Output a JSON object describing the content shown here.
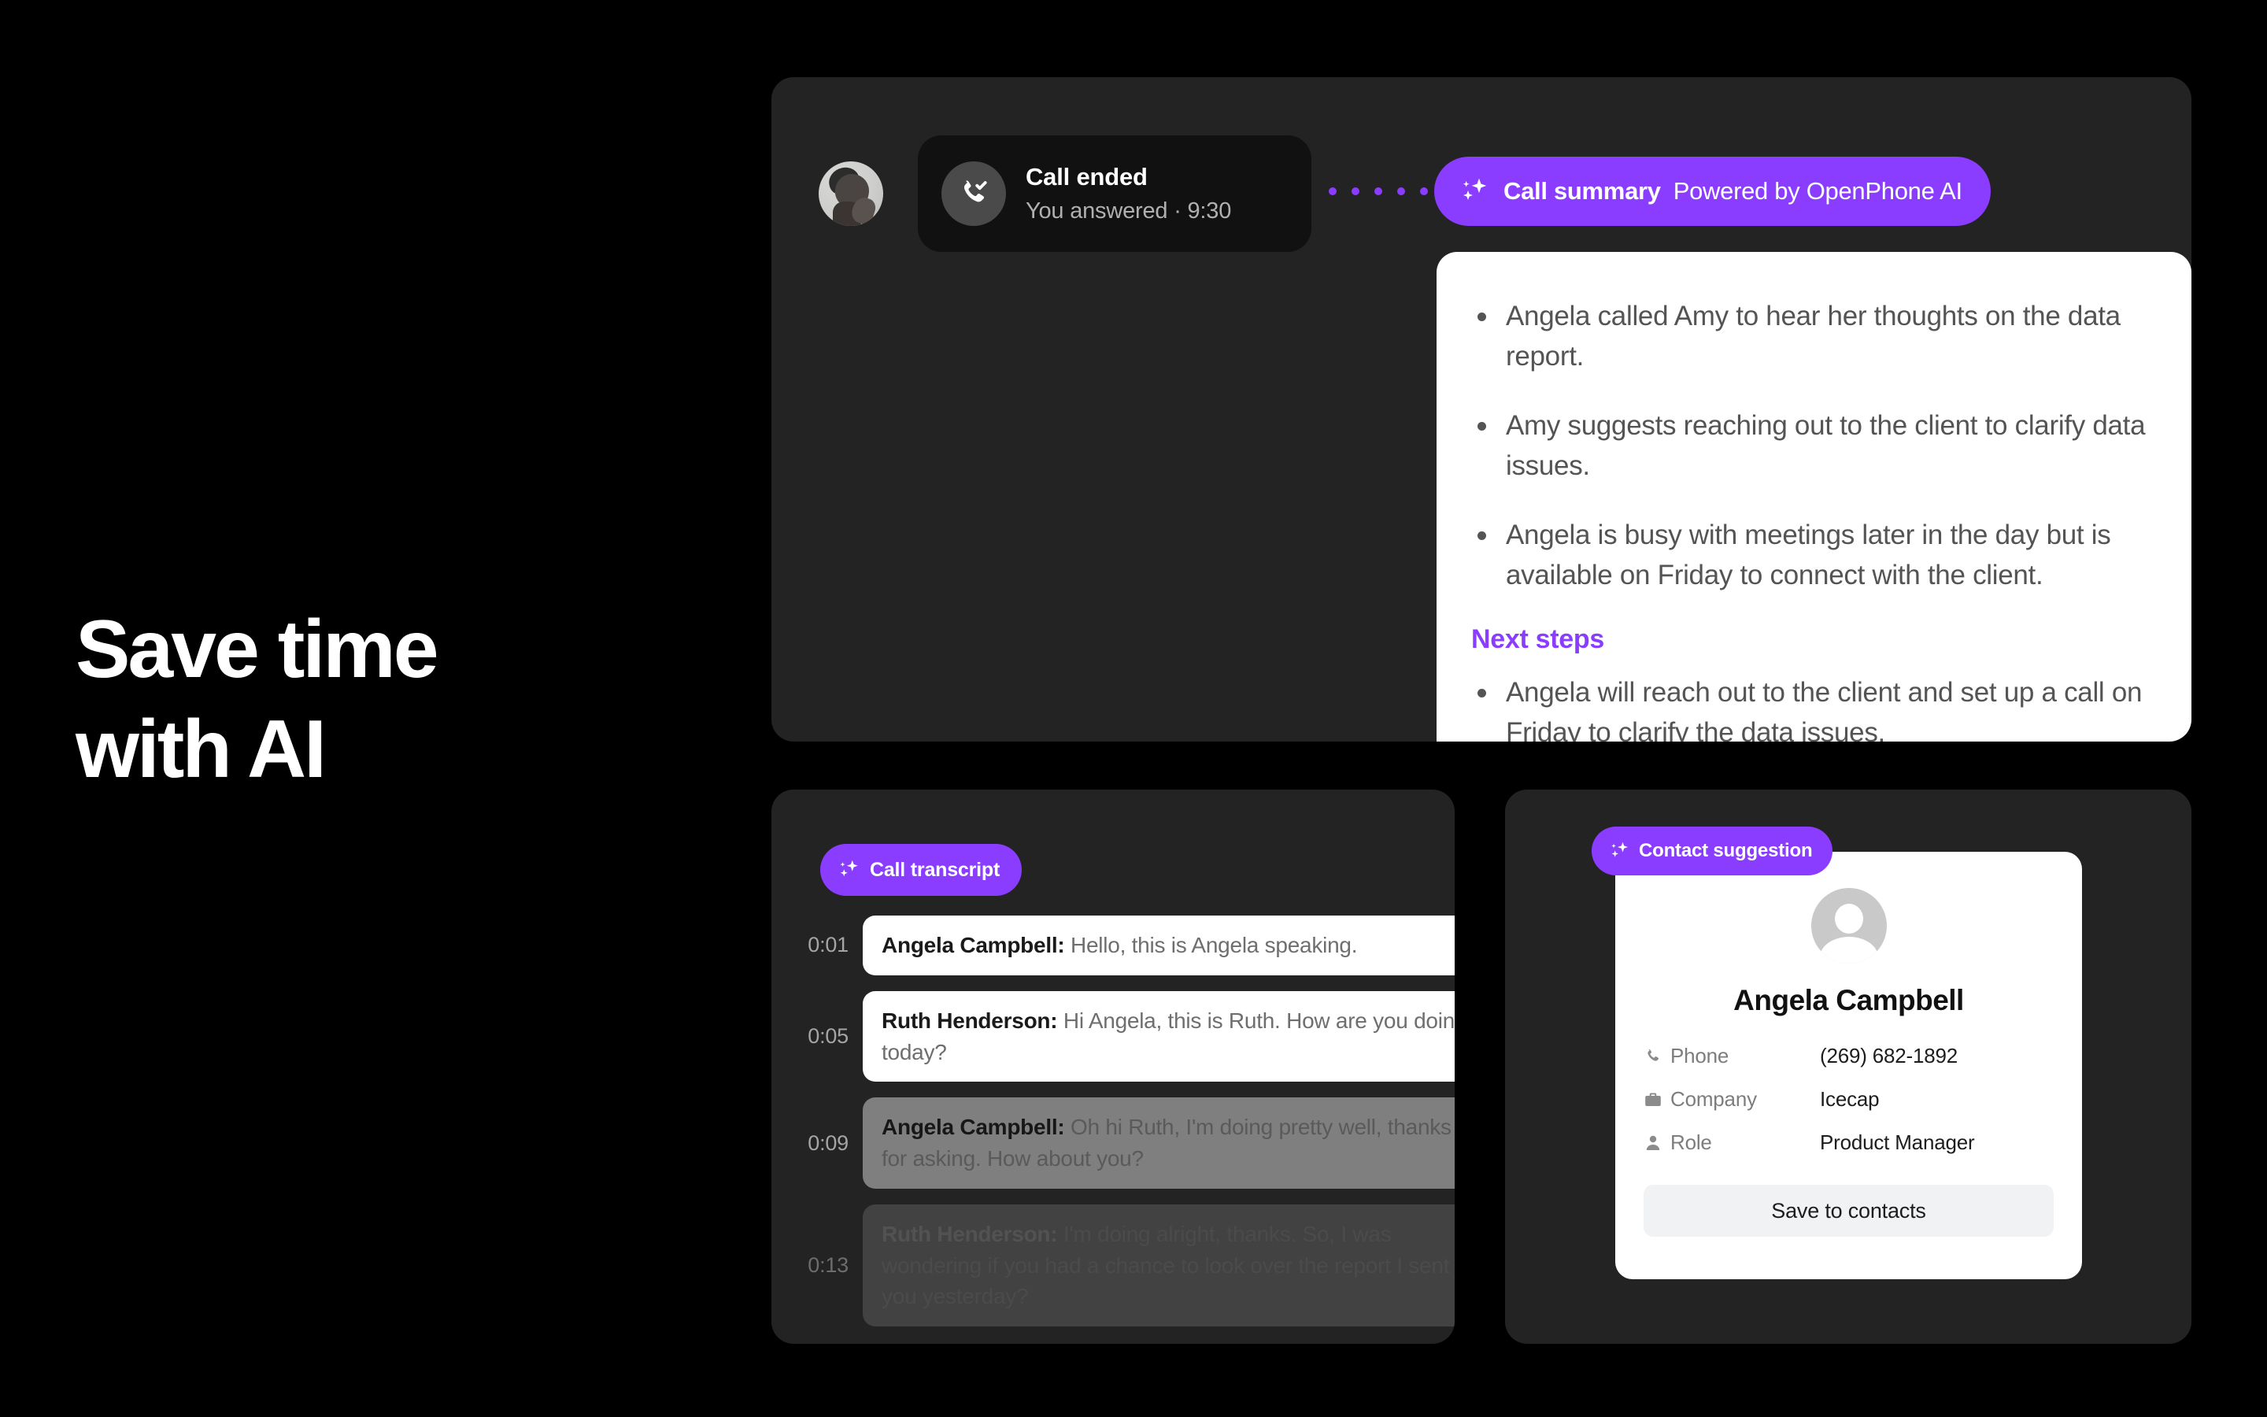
{
  "headline": {
    "line1": "Save time",
    "line2": "with AI"
  },
  "colors": {
    "accent": "#8b3dff",
    "panel_bg": "#232323",
    "page_bg": "#000000",
    "card_bg": "#ffffff"
  },
  "call_event": {
    "avatar_alt": "caller-photo",
    "title": "Call ended",
    "subtitle": "You answered · 9:30",
    "icon": "phone-check-icon",
    "connector_dots": 7
  },
  "summary_badge": {
    "icon": "sparkle-icon",
    "label": "Call summary",
    "sublabel": "Powered by OpenPhone AI"
  },
  "summary": {
    "bullets": [
      "Angela called Amy to hear her thoughts on the data report.",
      "Amy suggests reaching out to the client to clarify data issues.",
      "Angela is busy with meetings later in the day but is available on Friday to connect with the client."
    ],
    "next_steps_title": "Next steps",
    "next_steps": [
      "Angela will reach out to the client and set up a call on Friday to clarify the data issues."
    ]
  },
  "transcript_badge": {
    "icon": "sparkle-icon",
    "label": "Call transcript"
  },
  "transcript": [
    {
      "time": "0:01",
      "speaker": "Angela Campbell:",
      "text": " Hello, this is Angela speaking."
    },
    {
      "time": "0:05",
      "speaker": "Ruth Henderson:",
      "text": " Hi Angela, this is Ruth. How are you doing today?"
    },
    {
      "time": "0:09",
      "speaker": "Angela Campbell:",
      "text": " Oh hi Ruth, I'm doing pretty well, thanks for asking. How about you?"
    },
    {
      "time": "0:13",
      "speaker": "Ruth Henderson:",
      "text": " I'm doing alright, thanks. So, I was wondering if you had a chance to look over the report I sent you yesterday?"
    }
  ],
  "contact_badge": {
    "icon": "sparkle-icon",
    "label": "Contact suggestion"
  },
  "contact": {
    "avatar": "person-avatar-icon",
    "name": "Angela Campbell",
    "fields": [
      {
        "icon": "phone-icon",
        "label": "Phone",
        "value": "(269) 682-1892"
      },
      {
        "icon": "briefcase-icon",
        "label": "Company",
        "value": "Icecap"
      },
      {
        "icon": "person-icon",
        "label": "Role",
        "value": "Product Manager"
      }
    ],
    "save_label": "Save to contacts"
  }
}
